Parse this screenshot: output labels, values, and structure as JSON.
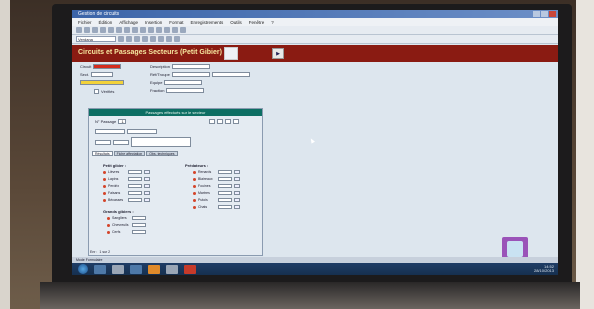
{
  "window": {
    "title": "Gestion de circuits",
    "menu": [
      "Fichier",
      "Édition",
      "Affichage",
      "Insertion",
      "Format",
      "Enregistrements",
      "Outils",
      "Fenêtre",
      "?"
    ],
    "toolbar_select": "Verdana"
  },
  "form": {
    "title": "Circuits et Passages Secteurs (Petit Gibier)",
    "icon_button": "▶",
    "fields": {
      "circuit_label": "Circuit",
      "circuit_value": "",
      "sect_label": "Sect.",
      "sect_value": "",
      "description_label": "Description",
      "description_value": "",
      "ref_label": "Réf/Troupe",
      "ref_value": "",
      "equipe_label": "Equipe",
      "equipe_value": "",
      "checked_label": "Vérifiés",
      "fraction_label": "Fraction"
    }
  },
  "subform": {
    "header": "Passages effectués sur le secteur",
    "date_label": "N° Passage",
    "date_value": "1",
    "tabs": [
      "Résultats",
      "Fiche affectation",
      "Obs. techniques"
    ],
    "left_section_title": "Petit gibier :",
    "left_items": [
      "Lièvres",
      "Lapins",
      "Perdrix",
      "Faisans",
      "Bécasses"
    ],
    "left_section2_title": "Grands gibiers :",
    "left_items2": [
      "Sangliers",
      "Chevreuils",
      "Cerfs"
    ],
    "right_section_title": "Prédateurs :",
    "right_items": [
      "Renards",
      "Blaireaux",
      "Fouines",
      "Martres",
      "Putois",
      "Chats"
    ]
  },
  "nav": {
    "record_label": "Enr :",
    "record_value": "1 sur 2"
  },
  "status": {
    "text": "Mode Formulaire"
  },
  "taskbar": {
    "time": "14:52",
    "date": "28/10/2013"
  }
}
